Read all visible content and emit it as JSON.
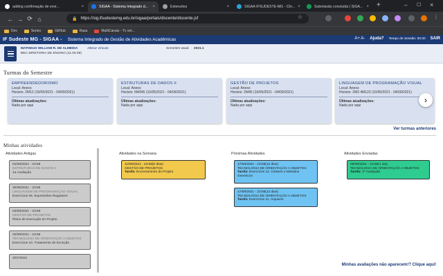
{
  "browser": {
    "tabs": [
      {
        "label": "adding confirmação de envi...",
        "color": "#ffffff"
      },
      {
        "label": "SIGAA - Sistema Integrado d...",
        "color": "#1c73e8"
      },
      {
        "label": "Extensões",
        "color": "#9aa0a6"
      },
      {
        "label": "SIGAA IFSUDESTE-MG - Chr...",
        "color": "#2aa3d9"
      },
      {
        "label": "Submissão concluída | SIGA...",
        "color": "#0f9d58"
      }
    ],
    "new_tab": "+",
    "url": "https://sig.ifsudestemg.edu.br/sigaa/portais/discente/discente.jsf",
    "bookmarks": [
      "Dev",
      "Series",
      "GitHub",
      "Rasa",
      "MultiCanais - Tv onl..."
    ]
  },
  "sigaa": {
    "brand": "IF Sudeste MG - SIGAA -",
    "subtitle": "Sistema Integrado de Gestão de Atividades Acadêmicas",
    "font_controls": "A+  A-",
    "help": "Ajuda?",
    "session": "Tempo de Sessão: 00:30",
    "exit": "SAIR",
    "user_name": "MATHEUS WILLIAM R. DE ALMEIDA",
    "alter_link": "Alterar vínculo",
    "unit": "BEC-DIRETORIA DE ENSINO (11.00.09)",
    "semester_label": "Semestre atual:",
    "semester_value": "2021.1"
  },
  "semestre": {
    "title": "Turmas do Semestre",
    "cards": [
      {
        "name": "EMPREENDEDORISMO",
        "local": "Local: Anexo",
        "horario": "Horário: 2M12 (10/05/2021 - 04/09/2021)",
        "up": "Últimas atualizações:",
        "news": "Nada por aqui"
      },
      {
        "name": "ESTRUTURAS DE DADOS II",
        "local": "Local: Anexo",
        "horario": "Horário: 6M345 (10/05/2021 - 04/09/2021)",
        "up": "Últimas atualizações:",
        "news": "Nada por aqui"
      },
      {
        "name": "GESTÃO DE PROJETOS",
        "local": "Local: Anexo",
        "horario": "Horário: 2M45 (10/05/2021 - 04/09/2021)",
        "up": "Últimas atualizações:",
        "news": "Nada por aqui"
      },
      {
        "name": "LINGUAGEM DE PROGRAMAÇÃO VISUAL",
        "local": "Local: Anexo",
        "horario": "Horário: 2M3 4M123 (10/05/2021 - 04/09/2021)",
        "up": "Últimas atualizações:",
        "news": "Nada por aqui"
      }
    ],
    "next_icon": "›",
    "see_more": "Ver turmas anteriores"
  },
  "atividades": {
    "title": "Minhas atividades",
    "col_antigas": "Atividades Antigas",
    "col_semana": "Atividades na Semana",
    "col_proximas": "Próximas Atividades",
    "col_enviadas": "Atividades Enviadas",
    "antigas": [
      {
        "date": "01/08/2021 - 23:59",
        "course": "ESTRUTURAS DE DADOS II",
        "task": "1a Avaliação"
      },
      {
        "date": "30/08/2021 - 23:59",
        "course": "LINGUAGEM DE PROGRAMAÇÃO VISUAL",
        "task": "Exercícios 06. Expressões Regulares"
      },
      {
        "date": "02/09/2021 - 23:59",
        "course": "GESTÃO DE PROJETOS",
        "task": "Plano de Execução do Projeto"
      },
      {
        "date": "02/09/2021 - 23:59",
        "course": "TECNOLOGIA DE ORIENTAÇÃO A OBJETOS",
        "task": "Exercícios 10. Tratamento de Exceção"
      },
      {
        "date": "3/07/2021",
        "course": "",
        "task": ""
      }
    ],
    "semana": [
      {
        "date": "11/08/2021 - 23:59(0 dias)",
        "course": "GESTÃO DE PROJETOS",
        "task_label": "Tarefa:",
        "task": "Encerramento do Projeto",
        "color": "#f2c94c"
      }
    ],
    "proximas": [
      {
        "date": "17/08/2021 - 23:59(12 dias)",
        "course": "TECNOLOGIA DE ORIENTAÇÃO A OBJETOS",
        "task_label": "Tarefa:",
        "task": "Exercícios 12. Classes e Métodos Genéricos",
        "color": "#6fc3f2"
      },
      {
        "date": "17/08/2021 - 23:59(12 dias)",
        "course": "TECNOLOGIA DE ORIENTAÇÃO A OBJETOS",
        "task_label": "Tarefa:",
        "task": "Exercícios 11. Arquivos",
        "color": "#6fc3f2"
      }
    ],
    "enviadas": [
      {
        "date": "09/08/2021 - 23:59(1 dia)",
        "course": "TECNOLOGIA DE ORIENTAÇÃO A OBJETOS",
        "task_label": "Tarefa:",
        "task": "1ª Avaliação",
        "color": "#2ecc8f"
      }
    ],
    "footer_link": "Minhas avaliações não aparecem!? Clique aqui!"
  }
}
